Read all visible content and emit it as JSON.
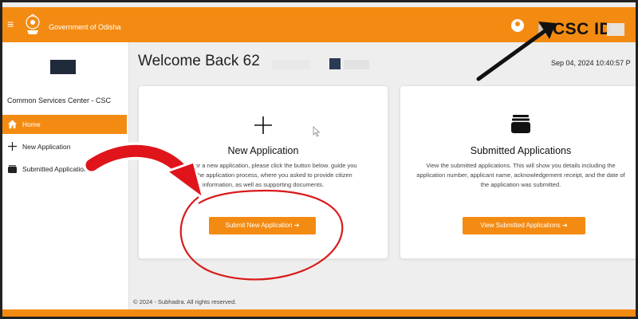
{
  "header": {
    "menu_icon": "hamburger-icon",
    "emblem_icon": "odisha-emblem-icon",
    "title": "Government of Odisha",
    "user_icon": "user-circle-icon",
    "csc_id_label": "CSC ID",
    "brand_color": "#f38b13"
  },
  "sidebar": {
    "org_name": "Common Services Center - CSC",
    "items": [
      {
        "label": "Home",
        "icon": "home-icon",
        "active": true
      },
      {
        "label": "New Application",
        "icon": "plus-icon",
        "active": false
      },
      {
        "label": "Submitted Applications",
        "icon": "stack-icon",
        "active": false
      }
    ]
  },
  "main": {
    "welcome": "Welcome Back 62",
    "datetime": "Sep 04, 2024 10:40:57 P",
    "cards": [
      {
        "icon": "plus-icon",
        "title": "New Application",
        "description": "To apply for a new application, please click the button below. guide you through the application process, where you asked to provide citizen information, as well as supporting documents.",
        "button": "Submit New Application"
      },
      {
        "icon": "stack-icon",
        "title": "Submitted Applications",
        "description": "View the submitted applications. This will show you details including the application number, applicant name, acknowledgement receipt, and the date of the application was submitted.",
        "button": "View Submitted Applications"
      }
    ]
  },
  "footer": {
    "copyright": "© 2024 - Subhadra. All rights reserved."
  },
  "annotation": {
    "arrow_color": "#e0141b",
    "pointer_color": "#111111"
  }
}
